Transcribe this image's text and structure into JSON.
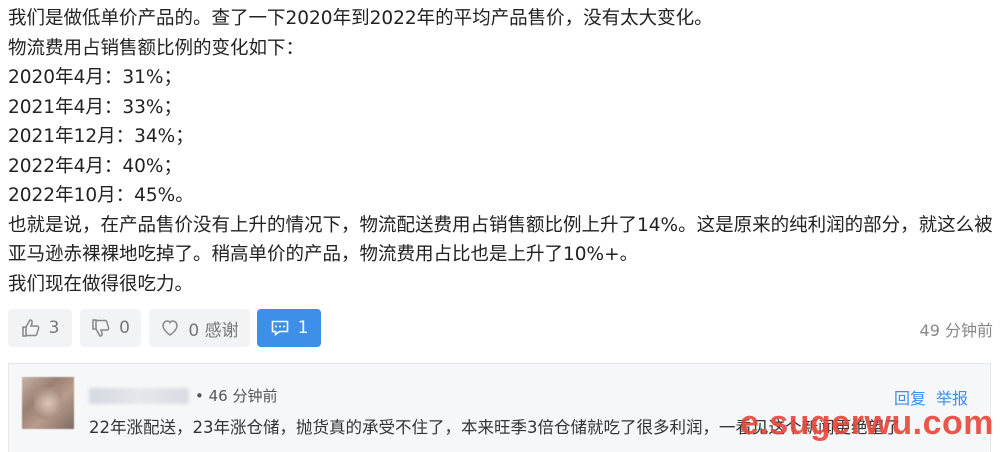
{
  "post": {
    "lines": [
      "我们是做低单价产品的。查了一下2020年到2022年的平均产品售价，没有太大变化。",
      "物流费用占销售额比例的变化如下：",
      "2020年4月：31%；",
      "2021年4月：33%；",
      "2021年12月：34%；",
      "2022年4月：40%；",
      "2022年10月：45%。",
      "也就是说，在产品售价没有上升的情况下，物流配送费用占销售额比例上升了14%。这是原来的纯利润的部分，就这么被",
      "亚马逊赤裸裸地吃掉了。稍高单价的产品，物流费用占比也是上升了10%+。",
      "我们现在做得很吃力。"
    ]
  },
  "actions": {
    "like_count": "3",
    "dislike_count": "0",
    "thanks_label": "0 感谢",
    "comment_count": "1",
    "time": "49 分钟前"
  },
  "comment": {
    "time": "• 46 分钟前",
    "reply": "回复",
    "report": "举报",
    "text": "22年涨配送，23年涨仓储，抛货真的承受不住了，本来旺季3倍仓储就吃了很多利润，一看见这个新闻更绝望了"
  },
  "watermark": "e.sugerwu.com",
  "colors": {
    "accent": "#3d8fe8",
    "watermark": "#e8463a"
  }
}
